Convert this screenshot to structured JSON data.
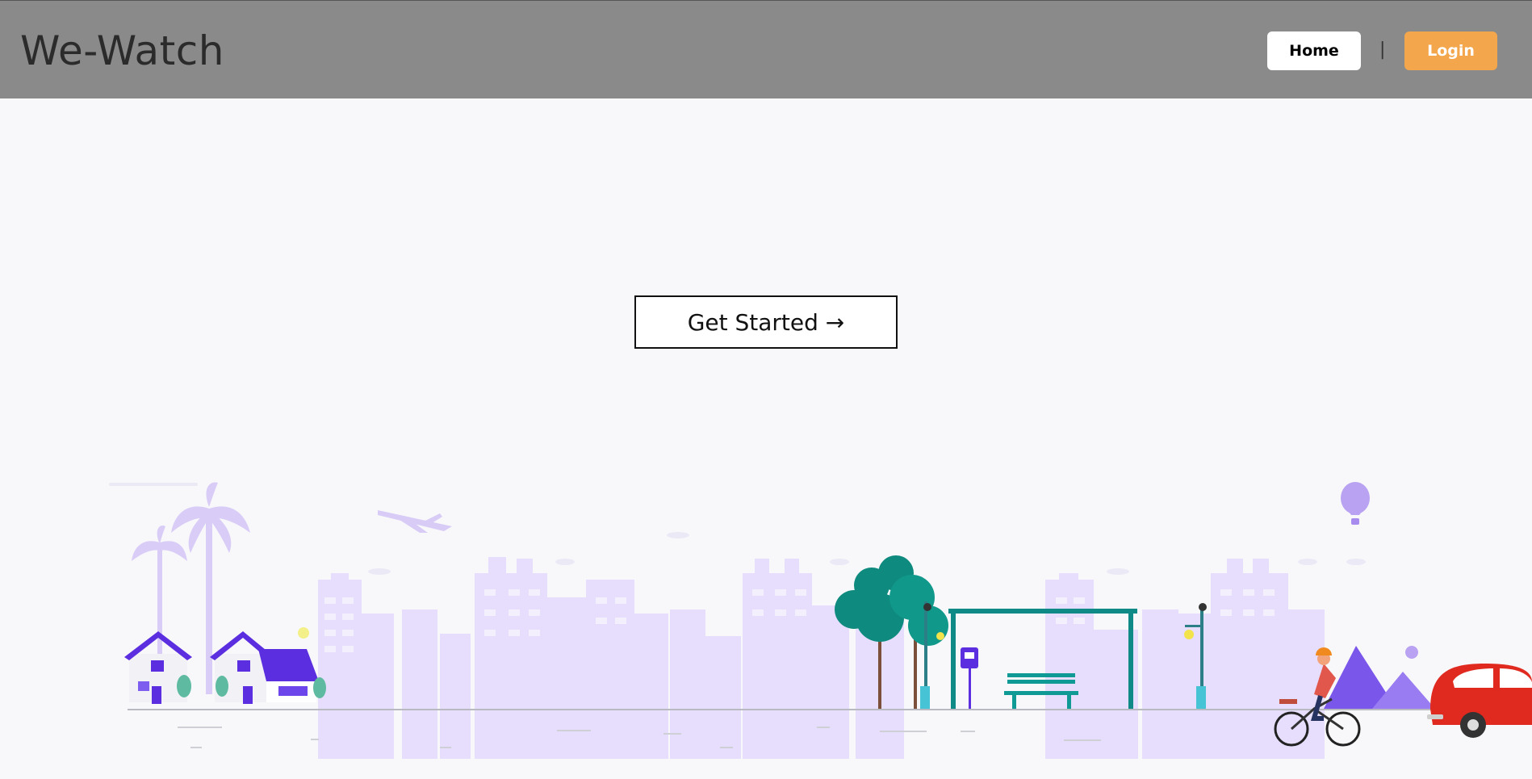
{
  "app": {
    "brand": "We-Watch"
  },
  "nav": {
    "home_label": "Home",
    "separator": "|",
    "login_label": "Login"
  },
  "hero": {
    "cta_label": "Get Started →"
  },
  "colors": {
    "navbar_bg": "#8a8a8a",
    "page_bg": "#f8f8fb",
    "login_accent": "#f3a64c",
    "city_lavender": "#e4dcfb",
    "house_purple": "#5b2ee0",
    "teal": "#0f8a87",
    "car_red": "#e02a1f"
  },
  "illustration": {
    "elements": [
      "palm-trees",
      "houses",
      "city-skyline",
      "airplane",
      "trees",
      "bus-stop",
      "bench",
      "street-lamps",
      "hot-air-balloon",
      "mountains",
      "cyclist",
      "red-car"
    ]
  }
}
